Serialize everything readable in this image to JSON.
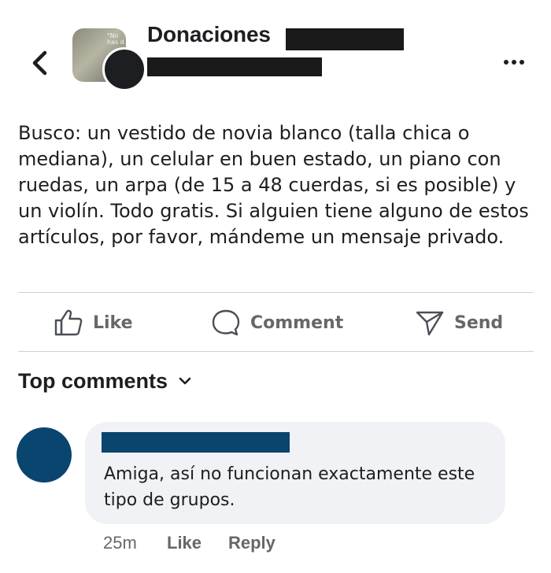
{
  "header": {
    "group_name": "Donaciones",
    "avatar_text": "\"No has d",
    "back_icon": "chevron-left-icon",
    "more_icon": "more-horizontal-icon"
  },
  "post": {
    "text": "Busco: un vestido de novia blanco (talla chica o mediana), un celular en buen estado, un piano con ruedas, un arpa (de 15 a 48 cuerdas, si es posible) y un violín. Todo gratis. Si alguien tiene alguno de estos artículos, por favor, mándeme un mensaje privado."
  },
  "actions": {
    "like_label": "Like",
    "comment_label": "Comment",
    "send_label": "Send"
  },
  "comments": {
    "header_label": "Top comments",
    "items": [
      {
        "text": "Amiga, así no funcionan exactamente este tipo de grupos.",
        "time": "25m",
        "like_label": "Like",
        "reply_label": "Reply"
      }
    ]
  },
  "colors": {
    "text_primary": "#1c1e21",
    "text_secondary": "#65676b",
    "bubble": "#f0f2f5",
    "commenter_accent": "#0a4570",
    "divider": "#ced0d4"
  }
}
